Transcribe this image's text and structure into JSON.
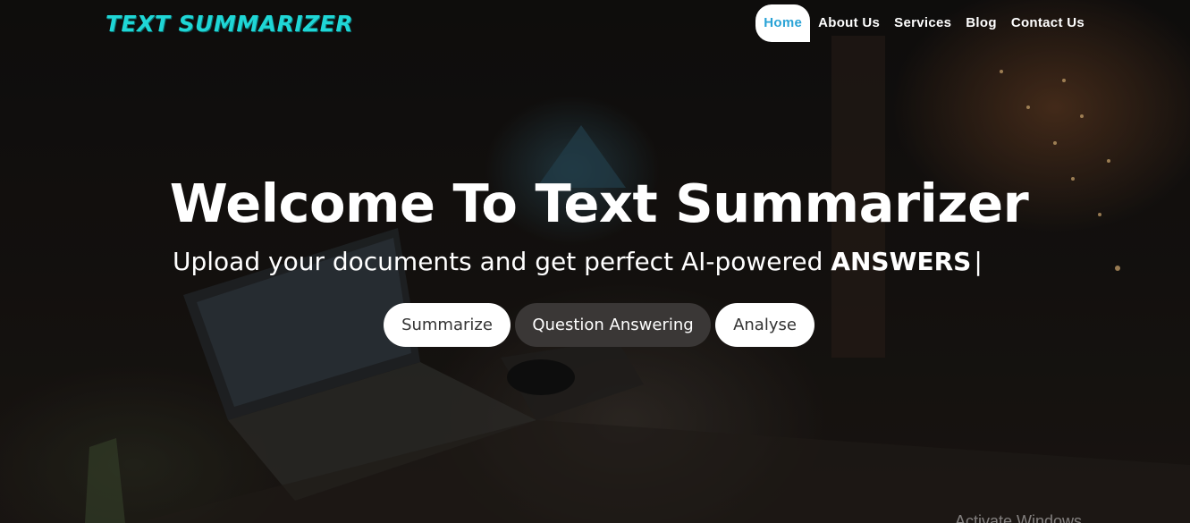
{
  "header": {
    "logo_text": "TEXT SUMMARIZER",
    "nav": [
      {
        "label": "Home",
        "active": true
      },
      {
        "label": "About Us",
        "active": false
      },
      {
        "label": "Services",
        "active": false
      },
      {
        "label": "Blog",
        "active": false
      },
      {
        "label": "Contact Us",
        "active": false
      }
    ]
  },
  "hero": {
    "title": "Welcome To Text Summarizer",
    "subtitle_prefix": "Upload your documents and get perfect AI-powered",
    "typed_word": "ANSWERS",
    "cursor": "|",
    "buttons": [
      {
        "label": "Summarize",
        "style": "light"
      },
      {
        "label": "Question Answering",
        "style": "dark"
      },
      {
        "label": "Analyse",
        "style": "light"
      }
    ]
  },
  "system": {
    "watermark": "Activate Windows"
  },
  "colors": {
    "logo": "#1fd6d6",
    "nav_active_text": "#2aa3d6",
    "dark_button": "#3a3736"
  }
}
